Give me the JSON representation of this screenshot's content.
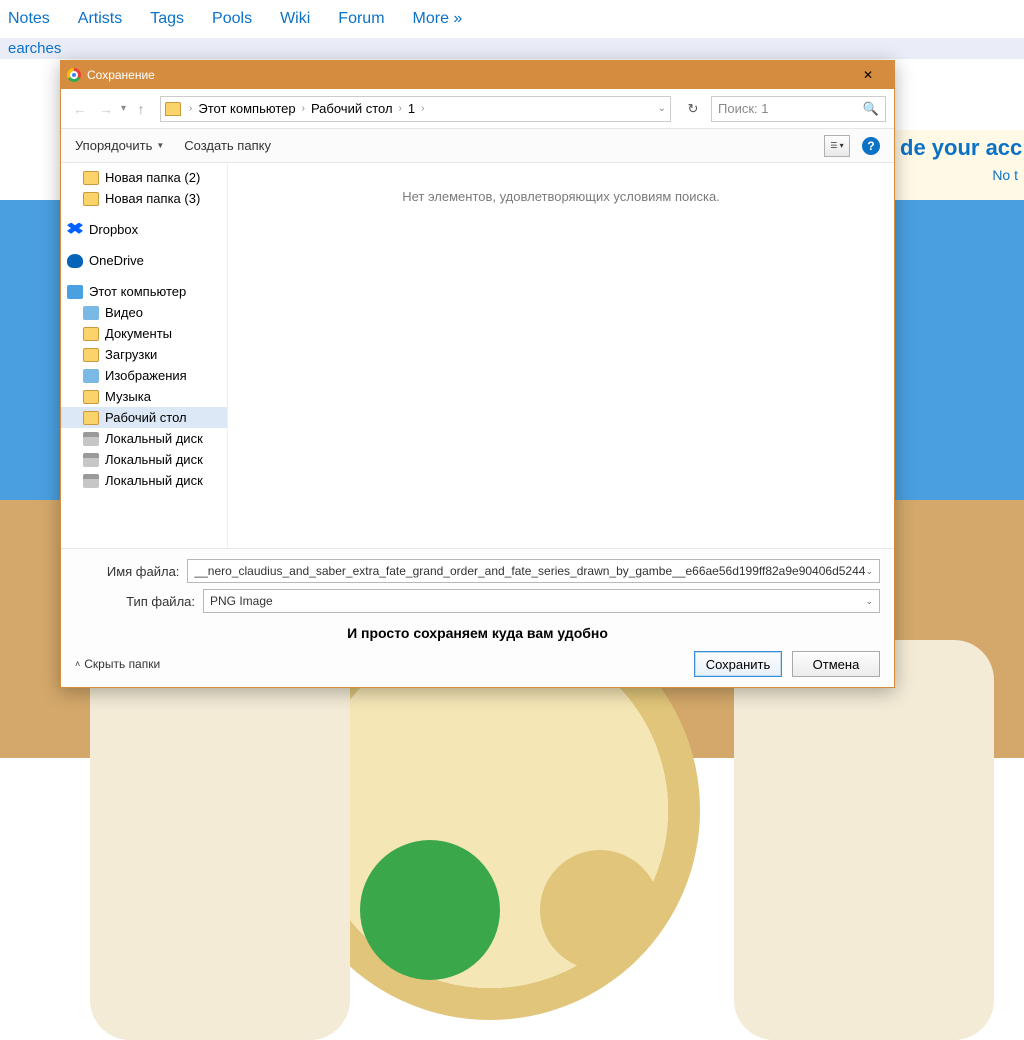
{
  "nav": {
    "items": [
      "Notes",
      "Artists",
      "Tags",
      "Pools",
      "Wiki",
      "Forum",
      "More »"
    ],
    "sub": "earches"
  },
  "banner": {
    "title": "de your acc",
    "sub": "No t"
  },
  "dialog": {
    "title": "Сохранение",
    "breadcrumb": {
      "items": [
        "Этот компьютер",
        "Рабочий стол",
        "1"
      ]
    },
    "search_placeholder": "Поиск: 1",
    "toolbar": {
      "organize": "Упорядочить",
      "newfolder": "Создать папку"
    },
    "content_empty": "Нет элементов, удовлетворяющих условиям поиска.",
    "sidebar": [
      {
        "label": "Новая папка (2)",
        "icon": "ic-folder",
        "indent": 1
      },
      {
        "label": "Новая папка (3)",
        "icon": "ic-folder",
        "indent": 1
      },
      {
        "label": "Dropbox",
        "icon": "ic-dropbox",
        "indent": 0,
        "root": true
      },
      {
        "label": "OneDrive",
        "icon": "ic-onedrive",
        "indent": 0,
        "root": true
      },
      {
        "label": "Этот компьютер",
        "icon": "ic-pc",
        "indent": 0,
        "root": true
      },
      {
        "label": "Видео",
        "icon": "ic-img",
        "indent": 1
      },
      {
        "label": "Документы",
        "icon": "ic-folder",
        "indent": 1
      },
      {
        "label": "Загрузки",
        "icon": "ic-folder",
        "indent": 1
      },
      {
        "label": "Изображения",
        "icon": "ic-img",
        "indent": 1
      },
      {
        "label": "Музыка",
        "icon": "ic-folder",
        "indent": 1
      },
      {
        "label": "Рабочий стол",
        "icon": "ic-folder",
        "indent": 1,
        "selected": true
      },
      {
        "label": "Локальный диск",
        "icon": "ic-drive",
        "indent": 1
      },
      {
        "label": "Локальный диск",
        "icon": "ic-drive",
        "indent": 1
      },
      {
        "label": "Локальный диск",
        "icon": "ic-drive",
        "indent": 1
      }
    ],
    "filename_label": "Имя файла:",
    "filetype_label": "Тип файла:",
    "filename_value": "__nero_claudius_and_saber_extra_fate_grand_order_and_fate_series_drawn_by_gambe__e66ae56d199ff82a9e90406d5244",
    "filetype_value": "PNG Image",
    "caption": "И просто сохраняем куда вам удобно",
    "hide_folders": "Скрыть папки",
    "save": "Сохранить",
    "cancel": "Отмена"
  },
  "help": "?"
}
